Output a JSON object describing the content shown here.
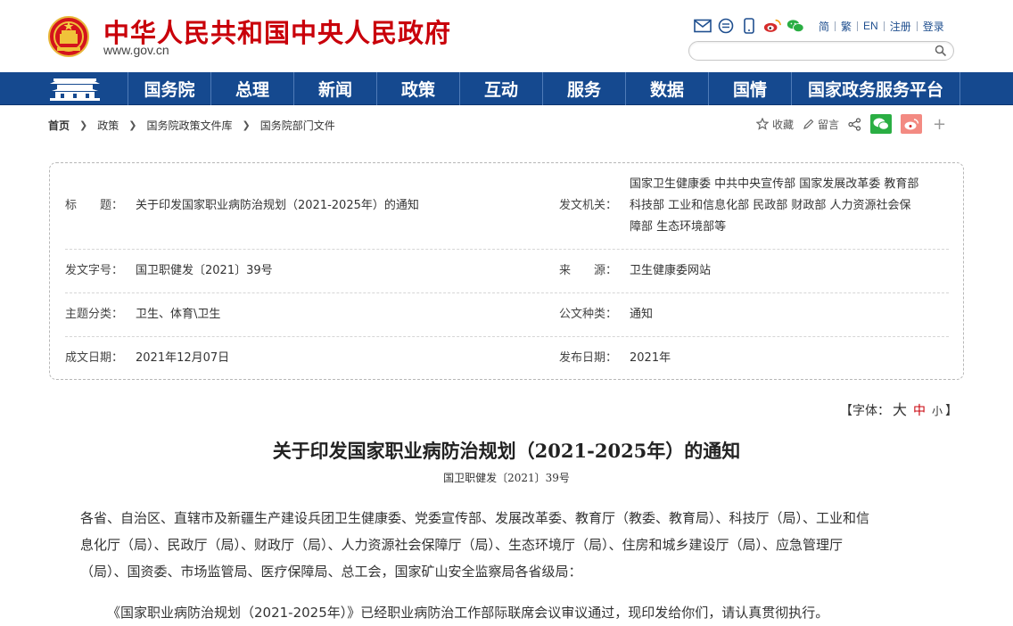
{
  "header": {
    "site_name": "中华人民共和国中央人民政府",
    "site_url": "www.gov.cn",
    "top_links": [
      "简",
      "繁",
      "EN",
      "注册",
      "登录"
    ],
    "icons": [
      "mail-icon",
      "chat-icon",
      "mobile-icon",
      "weibo-icon",
      "wechat-icon"
    ],
    "search_placeholder": ""
  },
  "nav": {
    "items": [
      "国务院",
      "总理",
      "新闻",
      "政策",
      "互动",
      "服务",
      "数据",
      "国情",
      "国家政务服务平台"
    ]
  },
  "breadcrumb": [
    "首页",
    "政策",
    "国务院政策文件库",
    "国务院部门文件"
  ],
  "tools": {
    "favorite": "收藏",
    "comment": "留言"
  },
  "info": {
    "title_label": "标　　题：",
    "title_value": "关于印发国家职业病防治规划（2021-2025年）的通知",
    "issuer_label": "发文机关：",
    "issuer_lines": [
      "国家卫生健康委 中共中央宣传部 国家发展改革委 教育部",
      "科技部 工业和信息化部 民政部 财政部 人力资源社会保",
      "障部 生态环境部等"
    ],
    "docno_label": "发文字号：",
    "docno_value": "国卫职健发〔2021〕39号",
    "source_label": "来　　源：",
    "source_value": "卫生健康委网站",
    "topic_label": "主题分类：",
    "topic_value": "卫生、体育\\卫生",
    "type_label": "公文种类：",
    "type_value": "通知",
    "date_label": "成文日期：",
    "date_value": "2021年12月07日",
    "pub_label": "发布日期：",
    "pub_value": "2021年"
  },
  "font_size": {
    "prefix": "【字体：",
    "big": "大",
    "mid": "中",
    "small": "小",
    "suffix": "】"
  },
  "article": {
    "title": "关于印发国家职业病防治规划（2021-2025年）的通知",
    "doc_no": "国卫职健发〔2021〕39号",
    "p1_lines": [
      "各省、自治区、直辖市及新疆生产建设兵团卫生健康委、党委宣传部、发展改革委、教育厅（教委、教育局）、科技厅（局）、工业和信",
      "息化厅（局）、民政厅（局）、财政厅（局）、人力资源社会保障厅（局）、生态环境厅（局）、住房和城乡建设厅（局）、应急管理厅",
      "（局）、国资委、市场监管局、医疗保障局、总工会，国家矿山安全监察局各省级局："
    ],
    "p2": "《国家职业病防治规划（2021-2025年）》已经职业病防治工作部际联席会议审议通过，现印发给你们，请认真贯彻执行。"
  }
}
